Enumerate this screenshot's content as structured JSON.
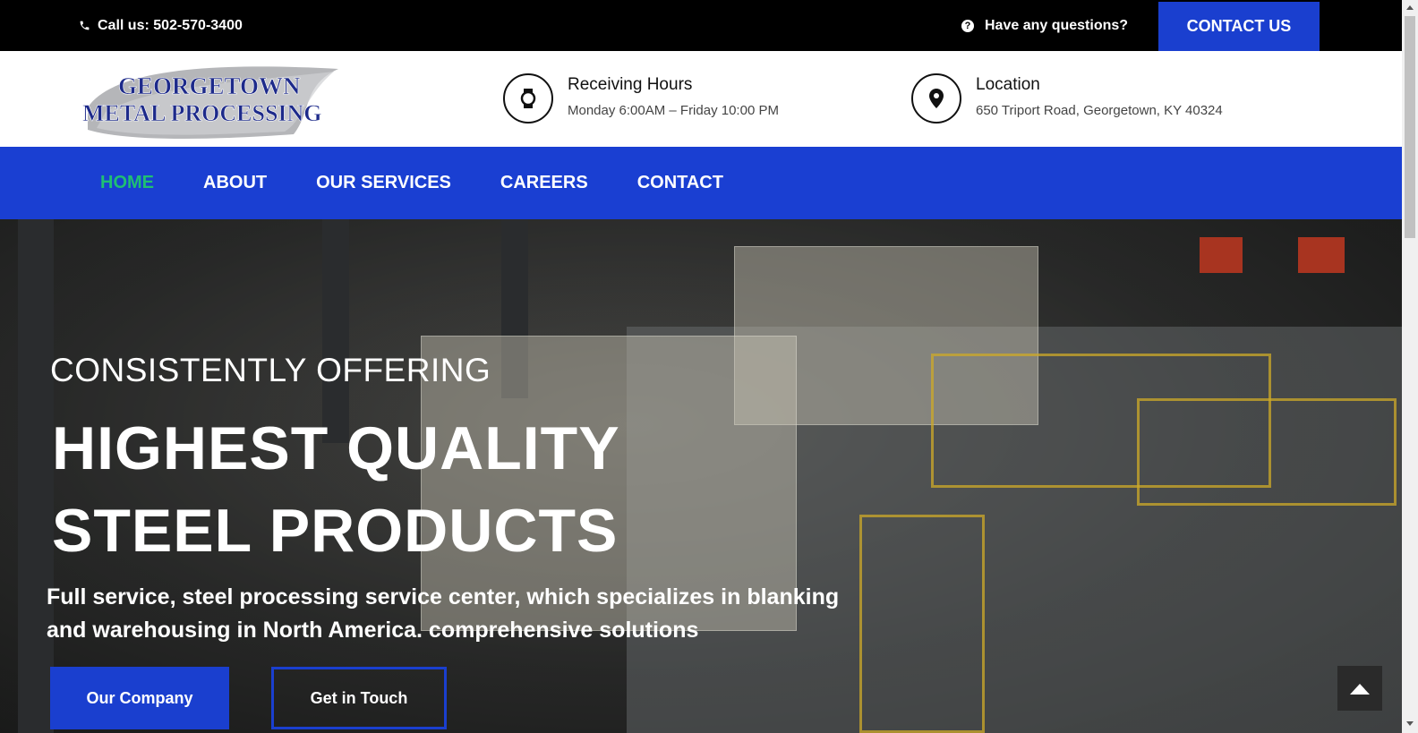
{
  "topbar": {
    "phone": "Call us: 502-570-3400",
    "phone_icon": "phone-icon",
    "question": "Have any questions?",
    "question_icon": "question-icon",
    "contact_button": "CONTACT US"
  },
  "header": {
    "logo_line1": "GEORGETOWN",
    "logo_line2": "METAL PROCESSING",
    "hours": {
      "icon": "watch-icon",
      "title": "Receiving Hours",
      "value": "Monday 6:00AM – Friday 10:00 PM"
    },
    "location": {
      "icon": "map-pin-icon",
      "title": "Location",
      "value": "650 Triport Road, Georgetown, KY 40324"
    }
  },
  "nav": {
    "items": [
      {
        "label": "HOME",
        "active": true
      },
      {
        "label": "ABOUT",
        "active": false
      },
      {
        "label": "OUR SERVICES",
        "active": false
      },
      {
        "label": "CAREERS",
        "active": false
      },
      {
        "label": "CONTACT",
        "active": false
      }
    ]
  },
  "hero": {
    "subtitle": "CONSISTENTLY OFFERING",
    "title_line1": "HIGHEST QUALITY",
    "title_line2": "STEEL PRODUCTS",
    "description_line1": "Full service, steel processing service center, which specializes in blanking",
    "description_line2": "and warehousing in North America. comprehensive solutions",
    "primary_button": "Our Company",
    "secondary_button": "Get in Touch",
    "back_to_top_icon": "chevron-up-icon"
  },
  "colors": {
    "brand_blue": "#1a3fd2",
    "active_nav": "#1fbf73",
    "topbar_bg": "#000000"
  }
}
